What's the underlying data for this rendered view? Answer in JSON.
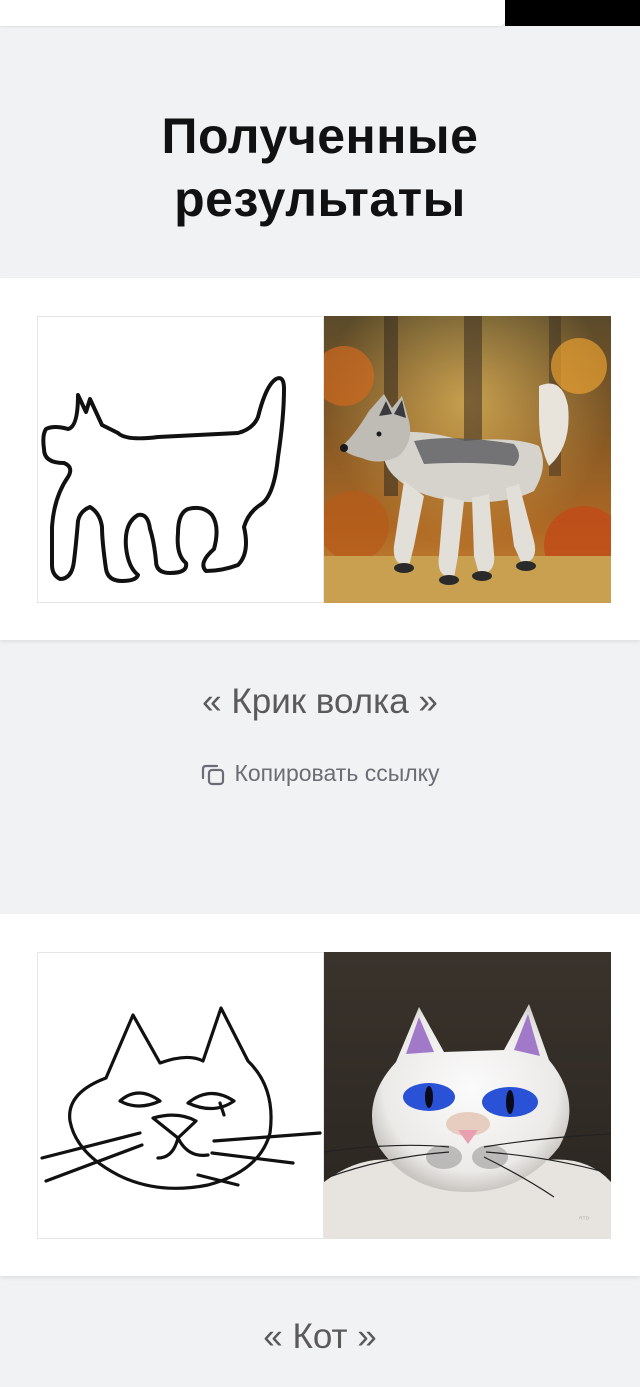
{
  "heading": {
    "line1": "Полученные",
    "line2": "результаты"
  },
  "results": [
    {
      "caption": "« Крик волка »",
      "copy_label": "Копировать ссылку"
    },
    {
      "caption": "« Кот »"
    }
  ],
  "icons": {
    "copy": "copy-icon"
  },
  "colors": {
    "background": "#f1f2f4",
    "card": "#ffffff",
    "caption": "#5a5a5a",
    "link": "#6a6e74"
  }
}
